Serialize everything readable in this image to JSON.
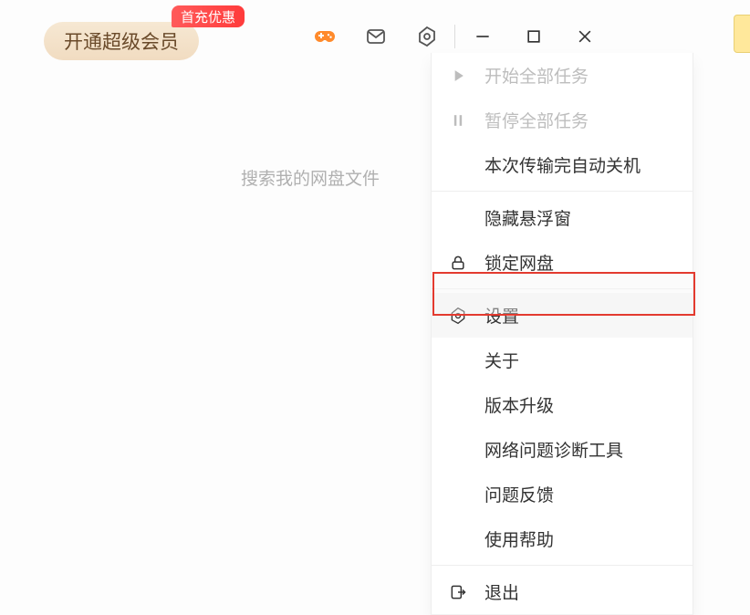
{
  "header": {
    "vip_label": "开通超级会员",
    "promo_badge": "首充优惠"
  },
  "search": {
    "placeholder": "搜索我的网盘文件"
  },
  "dropdown": {
    "items": [
      {
        "label": "开始全部任务",
        "icon": "play",
        "disabled": true
      },
      {
        "label": "暂停全部任务",
        "icon": "pause",
        "disabled": true
      },
      {
        "label": "本次传输完自动关机",
        "icon": "",
        "disabled": false
      },
      {
        "label": "隐藏悬浮窗",
        "icon": "",
        "disabled": false
      },
      {
        "label": "锁定网盘",
        "icon": "lock",
        "disabled": false
      },
      {
        "label": "设置",
        "icon": "gear",
        "disabled": false,
        "highlighted": true
      },
      {
        "label": "关于",
        "icon": "",
        "disabled": false
      },
      {
        "label": "版本升级",
        "icon": "",
        "disabled": false
      },
      {
        "label": "网络问题诊断工具",
        "icon": "",
        "disabled": false
      },
      {
        "label": "问题反馈",
        "icon": "",
        "disabled": false
      },
      {
        "label": "使用帮助",
        "icon": "",
        "disabled": false
      },
      {
        "label": "退出",
        "icon": "exit",
        "disabled": false
      }
    ]
  }
}
